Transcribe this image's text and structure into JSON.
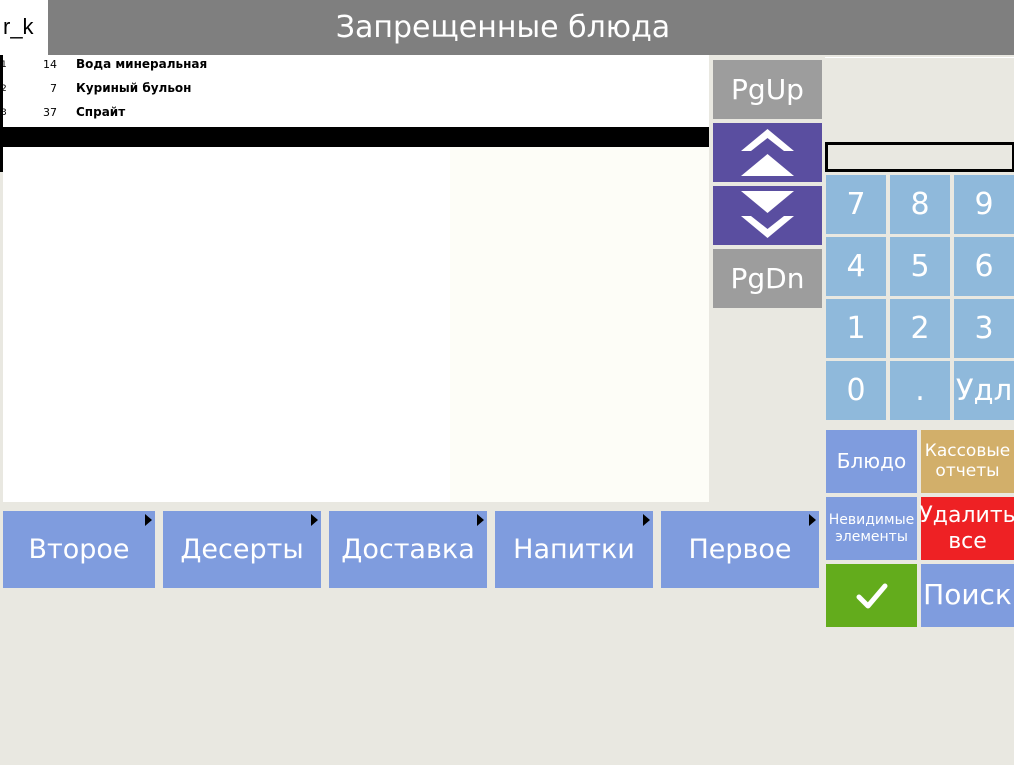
{
  "header": {
    "logo": "r_k",
    "title": "Запрещенные блюда"
  },
  "list": {
    "rows": [
      {
        "num": "1",
        "qty": "14",
        "name": "Вода минеральная"
      },
      {
        "num": "2",
        "qty": "7",
        "name": "Куриный бульон"
      },
      {
        "num": "3",
        "qty": "37",
        "name": "Спрайт"
      }
    ]
  },
  "nav": {
    "pgup": "PgUp",
    "up_icon": "double-chevron-up",
    "down_icon": "double-chevron-down",
    "pgdn": "PgDn"
  },
  "keypad": {
    "keys": [
      "7",
      "8",
      "9",
      "4",
      "5",
      "6",
      "1",
      "2",
      "3",
      "0",
      ".",
      "Удл"
    ]
  },
  "functions": {
    "dish": "Блюдо",
    "cash_reports": "Кассовые отчеты",
    "invisible": "Невидимые элементы",
    "delete_all": "Удалить все",
    "confirm_icon": "checkmark",
    "search": "Поиск"
  },
  "categories": [
    "Второе",
    "Десерты",
    "Доставка",
    "Напитки",
    "Первое"
  ],
  "colors": {
    "title_bar": "#7f7f7f",
    "nav_purple": "#5a4ea0",
    "nav_gray": "#9d9d9d",
    "keypad_blue": "#8fb9db",
    "category_blue": "#7f9cde",
    "reports_tan": "#d2af6a",
    "delete_red": "#ee2124",
    "confirm_green": "#63ac1c"
  }
}
